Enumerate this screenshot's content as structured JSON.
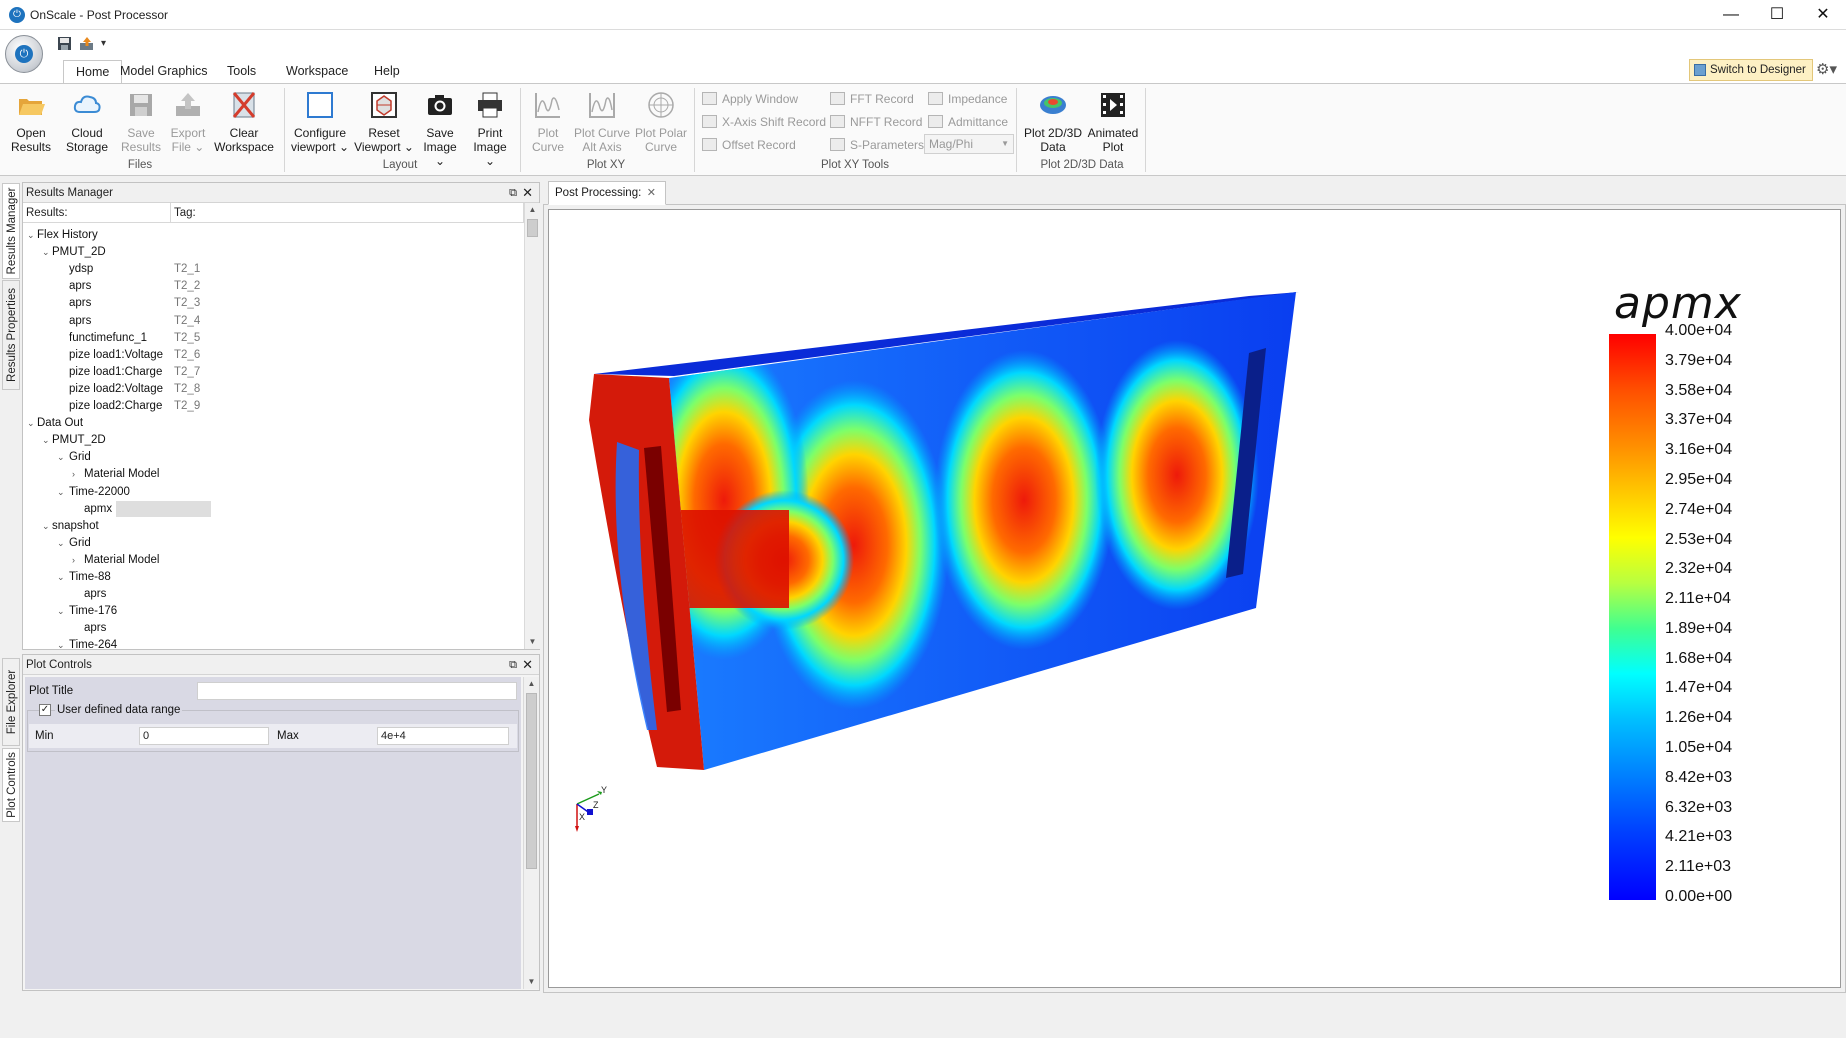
{
  "window": {
    "title": "OnScale - Post Processor",
    "controls": {
      "minimize": "—",
      "maximize": "☐",
      "close": "✕"
    }
  },
  "quick_access": {
    "save_icon": "save-icon",
    "export_icon": "export-icon",
    "dropdown": "▾"
  },
  "tabs": [
    "Home",
    "Model Graphics",
    "Tools",
    "Workspace",
    "Help"
  ],
  "active_tab": "Home",
  "switch_designer_label": "Switch to Designer",
  "ribbon": {
    "files": {
      "group_label": "Files",
      "open": [
        "Open",
        "Results"
      ],
      "cloud": [
        "Cloud",
        "Storage"
      ],
      "save": [
        "Save",
        "Results"
      ],
      "export": [
        "Export",
        "File ⌄"
      ],
      "clear": [
        "Clear",
        "Workspace"
      ]
    },
    "layout": {
      "group_label": "Layout",
      "configure": [
        "Configure",
        "viewport ⌄"
      ],
      "reset": [
        "Reset",
        "Viewport ⌄"
      ],
      "save_image": [
        "Save",
        "Image ⌄"
      ],
      "print_image": [
        "Print",
        "Image ⌄"
      ]
    },
    "plotxy": {
      "group_label": "Plot XY",
      "plot_curve": [
        "Plot",
        "Curve"
      ],
      "plot_curve_alt": [
        "Plot Curve",
        "Alt Axis"
      ],
      "plot_polar": [
        "Plot Polar",
        "Curve"
      ]
    },
    "plotxy_tools": {
      "group_label": "Plot XY Tools",
      "apply_window": "Apply Window",
      "xaxis_shift": "X-Axis Shift Record",
      "offset_record": "Offset Record",
      "fft_record": "FFT Record",
      "nfft_record": "NFFT Record",
      "s_params": "S-Parameters",
      "impedance": "Impedance",
      "admittance": "Admittance",
      "mag_phi": "Mag/Phi"
    },
    "plot23d": {
      "group_label": "Plot 2D/3D Data",
      "plot_data": [
        "Plot 2D/3D",
        "Data"
      ],
      "animated": [
        "Animated",
        "Plot"
      ]
    }
  },
  "side_tabs_top": [
    "Results Manager",
    "Results Properties"
  ],
  "side_tabs_bottom": [
    "File Explorer",
    "Plot Controls"
  ],
  "results_manager": {
    "title": "Results Manager",
    "col_results": "Results:",
    "col_tag": "Tag:",
    "rows": [
      {
        "label": "Flex History",
        "tag": "",
        "caret": "⌄"
      },
      {
        "label": "PMUT_2D",
        "tag": "",
        "caret": "⌄"
      },
      {
        "label": "ydsp",
        "tag": "T2_1",
        "caret": ""
      },
      {
        "label": "aprs",
        "tag": "T2_2",
        "caret": ""
      },
      {
        "label": "aprs",
        "tag": "T2_3",
        "caret": ""
      },
      {
        "label": "aprs",
        "tag": "T2_4",
        "caret": ""
      },
      {
        "label": "functimefunc_1",
        "tag": "T2_5",
        "caret": ""
      },
      {
        "label": "pize load1:Voltage",
        "tag": "T2_6",
        "caret": ""
      },
      {
        "label": "pize load1:Charge",
        "tag": "T2_7",
        "caret": ""
      },
      {
        "label": "pize load2:Voltage",
        "tag": "T2_8",
        "caret": ""
      },
      {
        "label": "pize load2:Charge",
        "tag": "T2_9",
        "caret": ""
      },
      {
        "label": "Data Out",
        "tag": "",
        "caret": "⌄"
      },
      {
        "label": "PMUT_2D",
        "tag": "",
        "caret": "⌄"
      },
      {
        "label": "Grid",
        "tag": "",
        "caret": "⌄"
      },
      {
        "label": "Material Model",
        "tag": "",
        "caret": "›"
      },
      {
        "label": "Time-22000",
        "tag": "",
        "caret": "⌄"
      },
      {
        "label": "apmx",
        "tag": "",
        "caret": ""
      },
      {
        "label": "snapshot",
        "tag": "",
        "caret": "⌄"
      },
      {
        "label": "Grid",
        "tag": "",
        "caret": "⌄"
      },
      {
        "label": "Material Model",
        "tag": "",
        "caret": "›"
      },
      {
        "label": "Time-88",
        "tag": "",
        "caret": "⌄"
      },
      {
        "label": "aprs",
        "tag": "",
        "caret": ""
      },
      {
        "label": "Time-176",
        "tag": "",
        "caret": "⌄"
      },
      {
        "label": "aprs",
        "tag": "",
        "caret": ""
      },
      {
        "label": "Time-264",
        "tag": "",
        "caret": "⌄"
      }
    ]
  },
  "plot_controls": {
    "title": "Plot Controls",
    "plot_title_label": "Plot Title",
    "plot_title_value": "",
    "user_range_label": "User defined data range",
    "user_range_checked": "✓",
    "min_label": "Min",
    "min_value": "0",
    "max_label": "Max",
    "max_value": "4e+4"
  },
  "document_tab": {
    "label": "Post Processing:",
    "close": "✕"
  },
  "legend": {
    "title": "apmx",
    "ticks": [
      "4.00e+04",
      "3.79e+04",
      "3.58e+04",
      "3.37e+04",
      "3.16e+04",
      "2.95e+04",
      "2.74e+04",
      "2.53e+04",
      "2.32e+04",
      "2.11e+04",
      "1.89e+04",
      "1.68e+04",
      "1.47e+04",
      "1.26e+04",
      "1.05e+04",
      "8.42e+03",
      "6.32e+03",
      "4.21e+03",
      "2.11e+03",
      "0.00e+00"
    ]
  },
  "axes_triad": {
    "x": "X",
    "y": "Y",
    "z": "Z"
  },
  "colors": {
    "accent": "#1e73be",
    "designer_btn": "#fdf0c4"
  }
}
